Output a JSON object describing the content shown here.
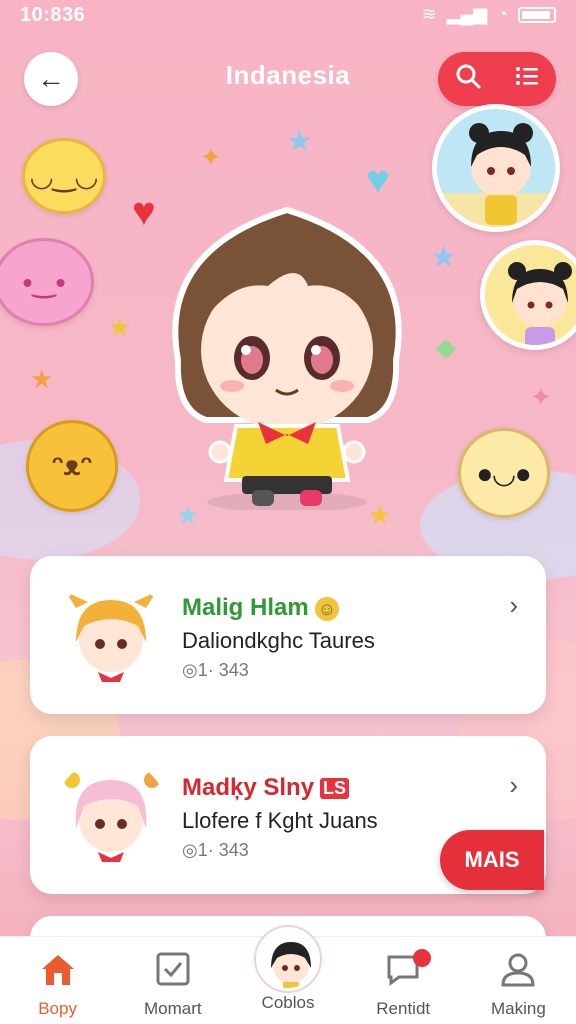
{
  "status_bar": {
    "time": "10:836"
  },
  "header": {
    "title": "Indanesia",
    "back_label": "←"
  },
  "colors": {
    "accent": "#ef3f4f",
    "background": "#f8b4c4",
    "green_name": "#2f9a35",
    "red_name": "#d8262e",
    "nav_active": "#ec5b2f"
  },
  "cards": [
    {
      "name": "Malig Hlam",
      "subtitle": "Daliondkghc Taures",
      "meta": "◎1· 343",
      "badge": "emoji"
    },
    {
      "name": "Madķy Slny",
      "badge_text": "LS",
      "subtitle": "Llofere f Kght Juans",
      "meta": "◎1· 343"
    }
  ],
  "mais_button": "MAIS",
  "bottom_nav": [
    {
      "label": "Bopy",
      "icon": "home-icon",
      "active": true
    },
    {
      "label": "Momart",
      "icon": "checkbox-icon",
      "active": false
    },
    {
      "label": "Coblos",
      "icon": "avatar",
      "active": false
    },
    {
      "label": "Rentidt",
      "icon": "chat-icon",
      "active": false
    },
    {
      "label": "Making",
      "icon": "user-icon",
      "active": false
    }
  ]
}
